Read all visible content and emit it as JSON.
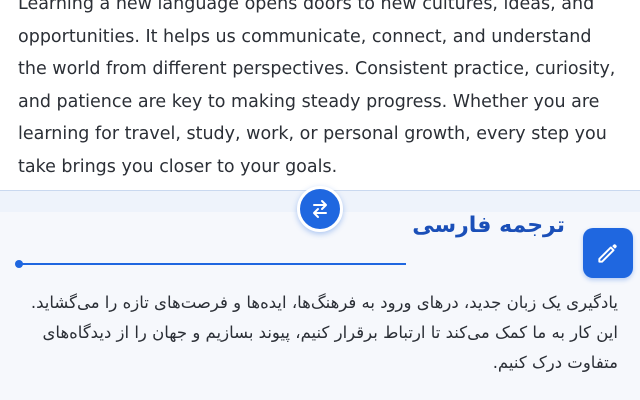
{
  "source": {
    "text": "Learning a new language opens doors to new cultures, ideas, and opportunities. It helps us communicate, connect, and understand the world from different perspectives. Consistent practice, curiosity, and patience are key to making steady progress. Whether you are learning for travel, study, work, or personal growth, every step you take brings you closer to your goals."
  },
  "swap": {
    "icon": "swap-arrows-icon"
  },
  "translation": {
    "title": "ترجمه فارسی",
    "edit_icon": "pencil-icon",
    "text": "یادگیری یک زبان جدید، درهای ورود به فرهنگ‌ها، ایده‌ها و فرصت‌های تازه را می‌گشاید. این کار به ما کمک می‌کند تا ارتباط برقرار کنیم، پیوند بسازیم و جهان را از دیدگاه‌های متفاوت درک کنیم."
  },
  "colors": {
    "accent": "#1f67e0",
    "title": "#1a4fb8",
    "text": "#2b2f36"
  }
}
